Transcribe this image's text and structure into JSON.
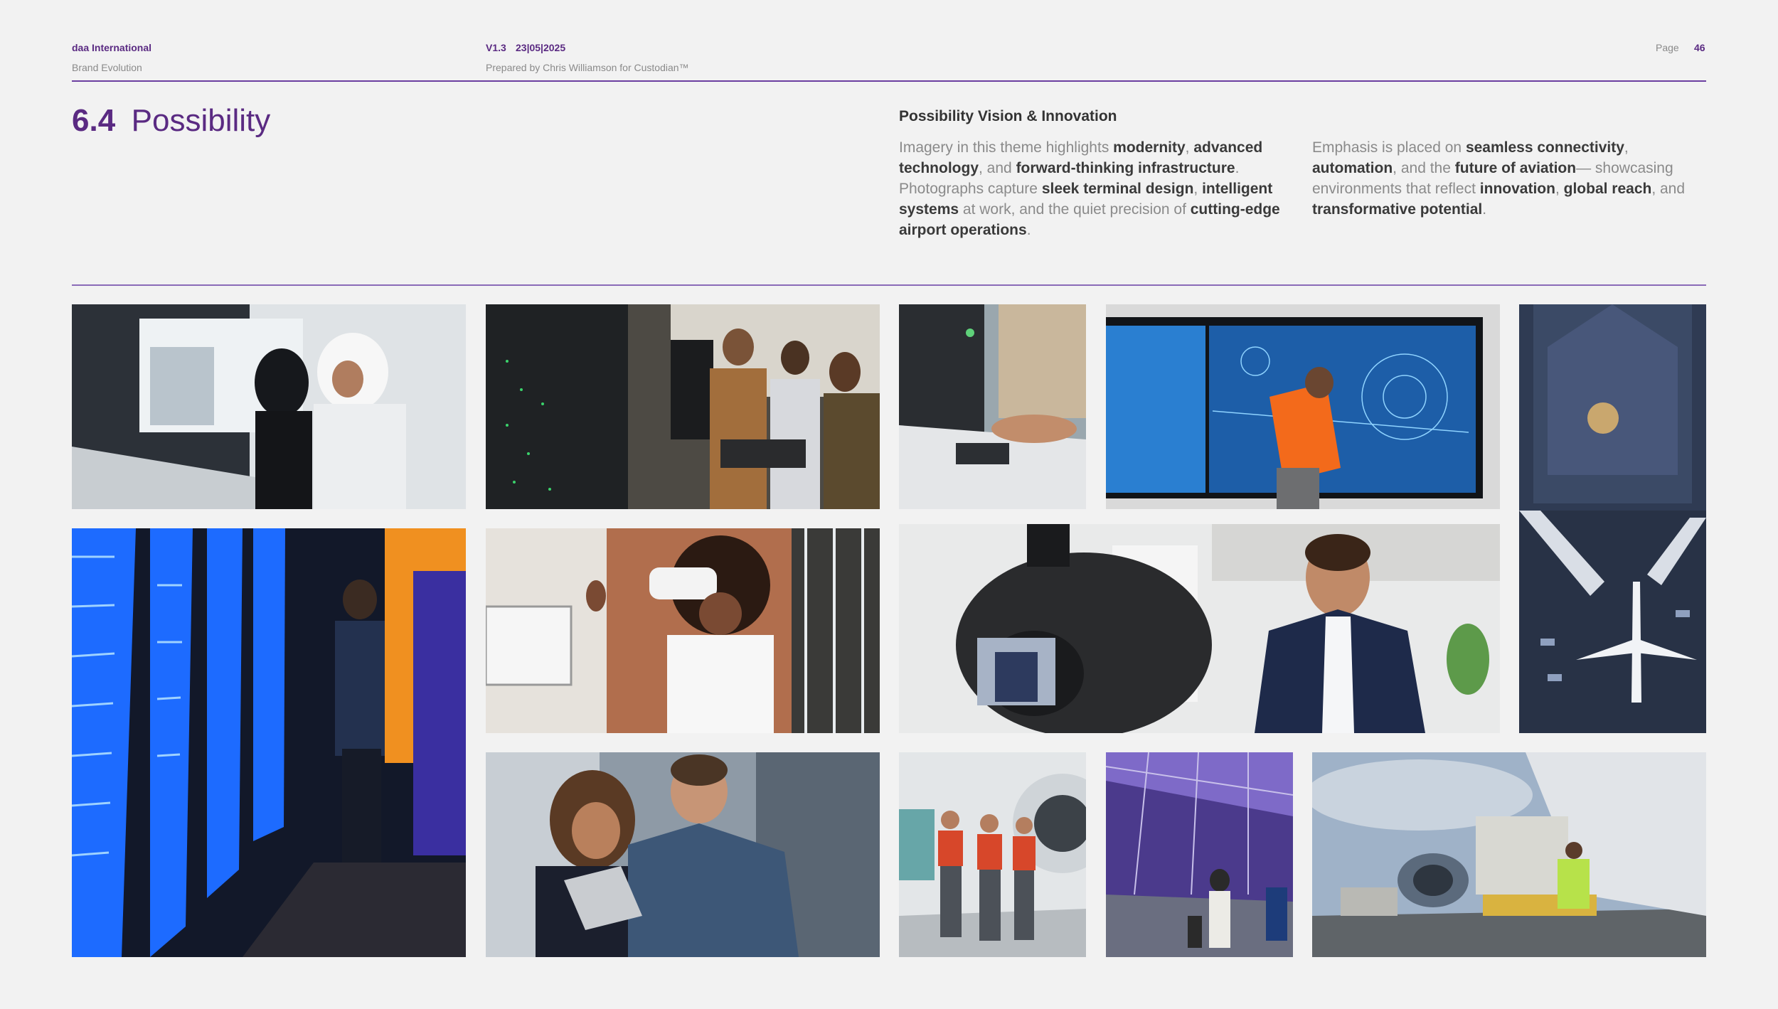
{
  "header": {
    "org": "daa International",
    "doc": "Brand Evolution",
    "version": "V1.3",
    "date": "23|05|2025",
    "prepared": "Prepared by Chris Williamson for Custodian™",
    "page_label": "Page",
    "page_number": "46"
  },
  "section": {
    "number": "6.4",
    "title": "Possibility"
  },
  "vision": {
    "heading": "Possibility Vision & Innovation",
    "col1": [
      {
        "t": "Imagery in this theme highlights ",
        "b": false
      },
      {
        "t": "modernity",
        "b": true
      },
      {
        "t": ", ",
        "b": false
      },
      {
        "t": "advanced technology",
        "b": true
      },
      {
        "t": ", and ",
        "b": false
      },
      {
        "t": "forward-thinking infrastructure",
        "b": true
      },
      {
        "t": ". Photographs capture ",
        "b": false
      },
      {
        "t": "sleek terminal design",
        "b": true
      },
      {
        "t": ", ",
        "b": false
      },
      {
        "t": "intelligent systems",
        "b": true
      },
      {
        "t": " at work, and the quiet precision of ",
        "b": false
      },
      {
        "t": "cutting-edge airport operations",
        "b": true
      },
      {
        "t": ".",
        "b": false
      }
    ],
    "col2": [
      {
        "t": "Emphasis is placed on ",
        "b": false
      },
      {
        "t": "seamless connectivity",
        "b": true
      },
      {
        "t": ", ",
        "b": false
      },
      {
        "t": "automation",
        "b": true
      },
      {
        "t": ", and the ",
        "b": false
      },
      {
        "t": "future of aviation",
        "b": true
      },
      {
        "t": "— showcasing environments that reflect ",
        "b": false
      },
      {
        "t": "innovation",
        "b": true
      },
      {
        "t": ", ",
        "b": false
      },
      {
        "t": "global reach",
        "b": true
      },
      {
        "t": ", and ",
        "b": false
      },
      {
        "t": "transformative potential",
        "b": true
      },
      {
        "t": ".",
        "b": false
      }
    ]
  },
  "colors": {
    "brand_purple": "#5a2a82",
    "background": "#f2f2f2"
  },
  "photos": [
    {
      "name": "photo-kiosk-couple"
    },
    {
      "name": "photo-server-team"
    },
    {
      "name": "photo-card-scanner"
    },
    {
      "name": "photo-radar-screen-worker"
    },
    {
      "name": "photo-aerial-airport"
    },
    {
      "name": "photo-datacenter-man"
    },
    {
      "name": "photo-vr-woman"
    },
    {
      "name": "photo-camera-presenter"
    },
    {
      "name": "photo-tablet-couple"
    },
    {
      "name": "photo-engineers-walking"
    },
    {
      "name": "photo-terminal-traveller"
    },
    {
      "name": "photo-cargo-loading"
    }
  ]
}
